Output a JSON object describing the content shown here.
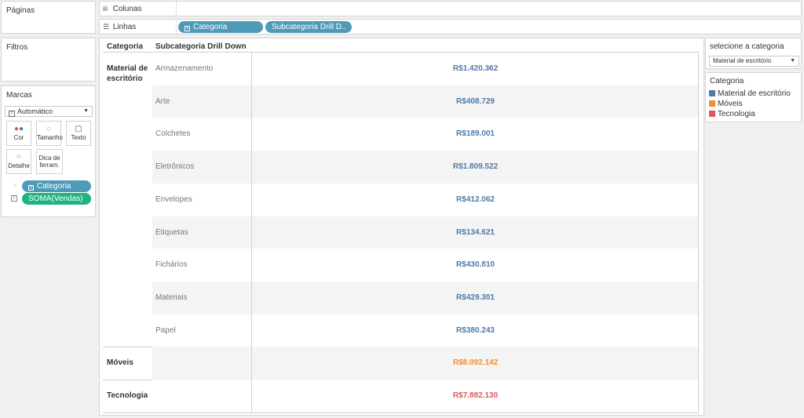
{
  "panels": {
    "pages_title": "Páginas",
    "filters_title": "Filtros",
    "marks_title": "Marcas"
  },
  "shelves": {
    "columns_label": "Colunas",
    "rows_label": "Linhas",
    "row_pills": [
      "Categoria",
      "Subcategoria Drill D.."
    ]
  },
  "marks": {
    "mark_type": "Automático",
    "buttons": [
      "Cor",
      "Tamanho",
      "Texto",
      "Detalhe",
      "Dica de ferram."
    ],
    "pills": [
      "Categoria",
      "SOMA(Vendas)"
    ]
  },
  "viz": {
    "headers": [
      "Categoria",
      "Subcategoria Drill Down"
    ],
    "categories": [
      {
        "name": "Material de escritório",
        "color": "#4e79a7",
        "rows": [
          {
            "sub": "Armazenamento",
            "value": "R$1.420.362"
          },
          {
            "sub": "Arte",
            "value": "R$408.729"
          },
          {
            "sub": "Colchetes",
            "value": "R$189.001"
          },
          {
            "sub": "Eletrônicos",
            "value": "R$1.809.522"
          },
          {
            "sub": "Envelopes",
            "value": "R$412.062"
          },
          {
            "sub": "Etiquetas",
            "value": "R$134.621"
          },
          {
            "sub": "Fichários",
            "value": "R$430.810"
          },
          {
            "sub": "Materiais",
            "value": "R$429.301"
          },
          {
            "sub": "Papel",
            "value": "R$380.243"
          }
        ]
      },
      {
        "name": "Móveis",
        "color": "#f28e2b",
        "rows": [
          {
            "sub": "",
            "value": "R$8.092.142"
          }
        ]
      },
      {
        "name": "Tecnologia",
        "color": "#e15759",
        "rows": [
          {
            "sub": "",
            "value": "R$7.882.130"
          }
        ]
      }
    ]
  },
  "filter_control": {
    "title": "selecione a categoria",
    "selected": "Material de escritório"
  },
  "legend": {
    "title": "Categoria",
    "items": [
      {
        "label": "Material de escritório",
        "color": "#4e79a7"
      },
      {
        "label": "Móveis",
        "color": "#f28e2b"
      },
      {
        "label": "Tecnologia",
        "color": "#e15759"
      }
    ]
  }
}
